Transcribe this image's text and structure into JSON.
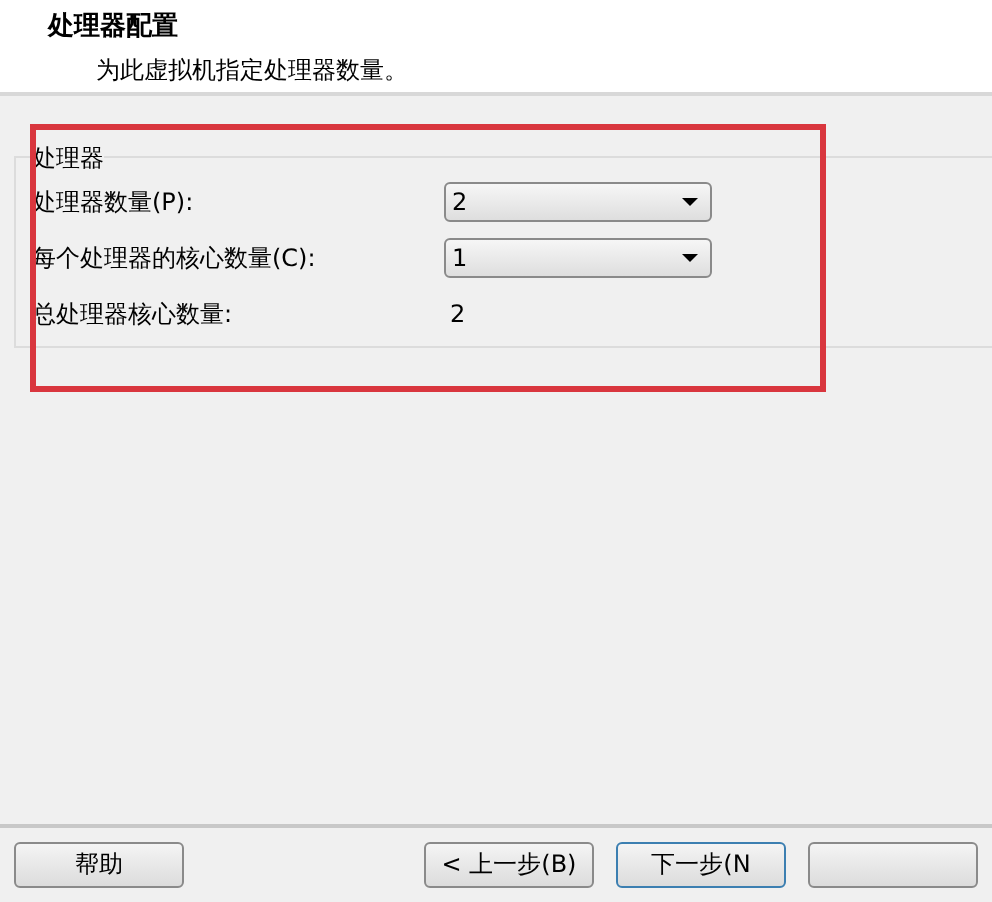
{
  "header": {
    "title": "处理器配置",
    "subtitle": "为此虚拟机指定处理器数量。"
  },
  "group": {
    "title": "处理器",
    "rows": [
      {
        "kind": "select",
        "label": "处理器数量(P):",
        "value": "2"
      },
      {
        "kind": "select",
        "label": "每个处理器的核心数量(C):",
        "value": "1"
      },
      {
        "kind": "readout",
        "label": "总处理器核心数量:",
        "value": "2"
      }
    ]
  },
  "highlight_box": {
    "shown": true
  },
  "buttons": [
    {
      "kind": "text",
      "label": "帮助",
      "focused": false
    },
    {
      "kind": "text",
      "label": "< 上一步(B)",
      "focused": false
    },
    {
      "kind": "text",
      "label": "下一步(N",
      "focused": true
    },
    {
      "kind": "blank",
      "focused": false
    }
  ]
}
